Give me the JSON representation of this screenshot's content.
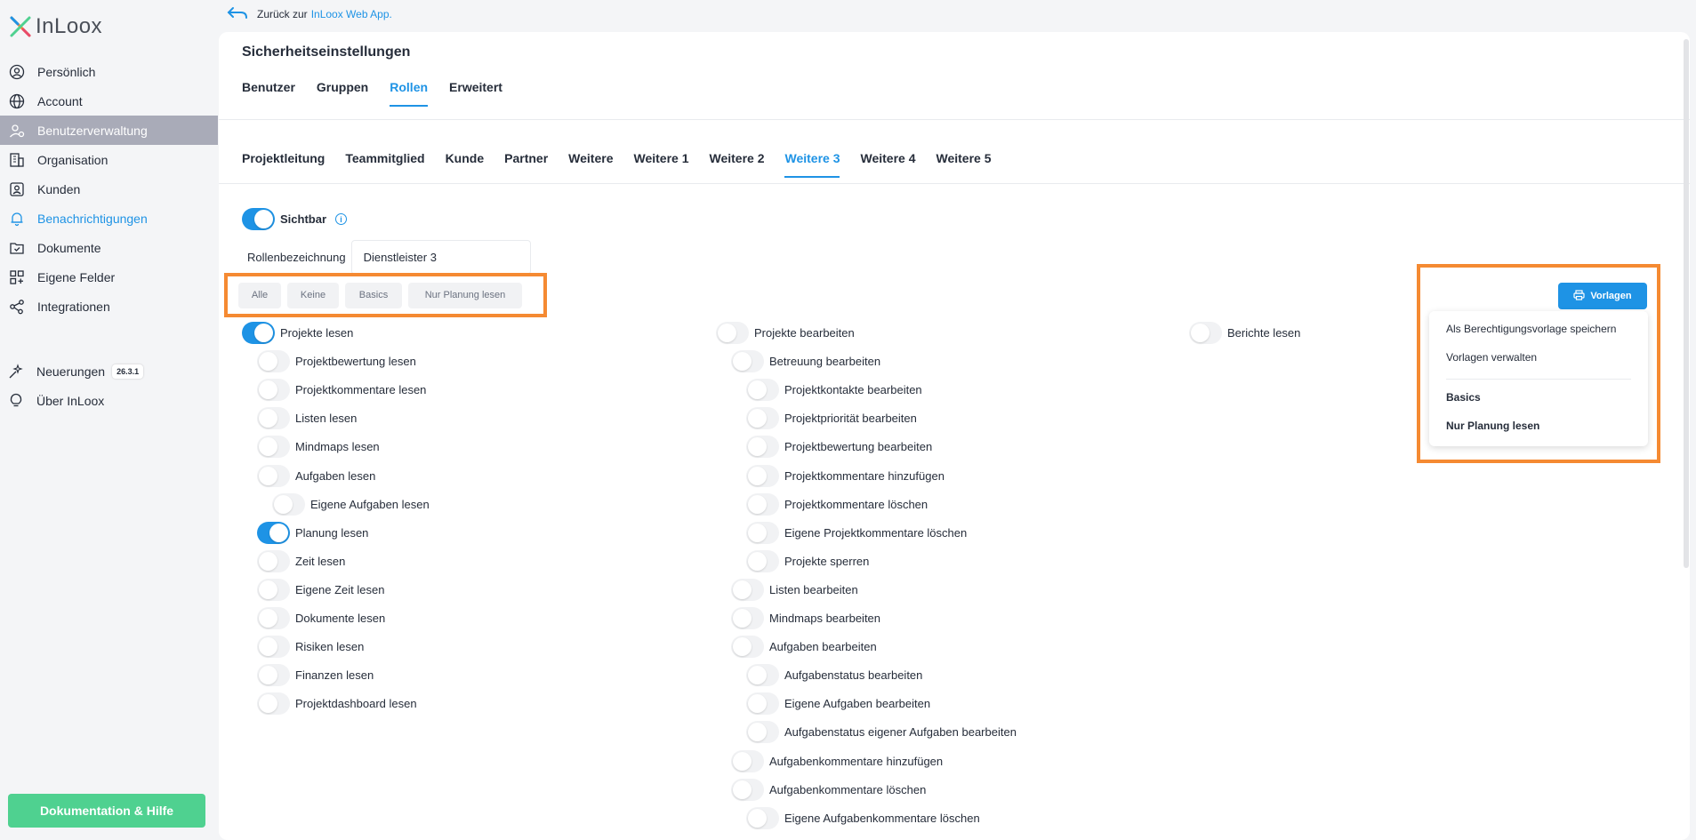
{
  "app": {
    "logo_text": "InLoox",
    "accent": "#1e93e5",
    "highlight": "#f58a32"
  },
  "back": {
    "text": "Zurück zur",
    "link": "InLoox Web App."
  },
  "sidebar": {
    "items": [
      {
        "label": "Persönlich",
        "icon": "person-circle-icon"
      },
      {
        "label": "Account",
        "icon": "globe-icon"
      },
      {
        "label": "Benutzerverwaltung",
        "icon": "users-gear-icon"
      },
      {
        "label": "Organisation",
        "icon": "building-icon"
      },
      {
        "label": "Kunden",
        "icon": "contact-card-icon"
      },
      {
        "label": "Benachrichtigungen",
        "icon": "bell-icon"
      },
      {
        "label": "Dokumente",
        "icon": "folder-check-icon"
      },
      {
        "label": "Eigene Felder",
        "icon": "grid-plus-icon"
      },
      {
        "label": "Integrationen",
        "icon": "share-nodes-icon"
      }
    ],
    "news": {
      "label": "Neuerungen",
      "badge": "26.3.1"
    },
    "about": {
      "label": "Über InLoox"
    },
    "help_button": "Dokumentation & Hilfe"
  },
  "main": {
    "title": "Sicherheitseinstellungen",
    "tabs": [
      "Benutzer",
      "Gruppen",
      "Rollen",
      "Erweitert"
    ],
    "active_tab": "Rollen",
    "role_tabs": [
      "Projektleitung",
      "Teammitglied",
      "Kunde",
      "Partner",
      "Weitere",
      "Weitere 1",
      "Weitere 2",
      "Weitere 3",
      "Weitere 4",
      "Weitere 5"
    ],
    "active_role_tab": "Weitere 3",
    "visible_label": "Sichtbar",
    "visible_on": true,
    "role_name_label": "Rollenbezeichnung",
    "role_name_value": "Dienstleister 3",
    "preset_buttons": [
      "Alle",
      "Keine",
      "Basics",
      "Nur Planung lesen"
    ],
    "templates_button": "Vorlagen",
    "templates_menu": {
      "actions": [
        "Als Berechtigungsvorlage speichern",
        "Vorlagen verwalten"
      ],
      "templates": [
        "Basics",
        "Nur Planung lesen"
      ]
    },
    "col1": [
      {
        "label": "Projekte lesen",
        "on": true
      },
      {
        "label": "Projektbewertung lesen",
        "on": false
      },
      {
        "label": "Projektkommentare lesen",
        "on": false
      },
      {
        "label": "Listen lesen",
        "on": false
      },
      {
        "label": "Mindmaps lesen",
        "on": false
      },
      {
        "label": "Aufgaben lesen",
        "on": false
      },
      {
        "label": "Eigene Aufgaben lesen",
        "on": false
      },
      {
        "label": "Planung lesen",
        "on": true
      },
      {
        "label": "Zeit lesen",
        "on": false
      },
      {
        "label": "Eigene Zeit lesen",
        "on": false
      },
      {
        "label": "Dokumente lesen",
        "on": false
      },
      {
        "label": "Risiken lesen",
        "on": false
      },
      {
        "label": "Finanzen lesen",
        "on": false
      },
      {
        "label": "Projektdashboard lesen",
        "on": false
      }
    ],
    "col2": [
      {
        "label": "Projekte bearbeiten",
        "on": false
      },
      {
        "label": "Betreuung bearbeiten",
        "on": false
      },
      {
        "label": "Projektkontakte bearbeiten",
        "on": false
      },
      {
        "label": "Projektpriorität bearbeiten",
        "on": false
      },
      {
        "label": "Projektbewertung bearbeiten",
        "on": false
      },
      {
        "label": "Projektkommentare hinzufügen",
        "on": false
      },
      {
        "label": "Projektkommentare löschen",
        "on": false
      },
      {
        "label": "Eigene Projektkommentare löschen",
        "on": false
      },
      {
        "label": "Projekte sperren",
        "on": false
      },
      {
        "label": "Listen bearbeiten",
        "on": false
      },
      {
        "label": "Mindmaps bearbeiten",
        "on": false
      },
      {
        "label": "Aufgaben bearbeiten",
        "on": false
      },
      {
        "label": "Aufgabenstatus bearbeiten",
        "on": false
      },
      {
        "label": "Eigene Aufgaben bearbeiten",
        "on": false
      },
      {
        "label": "Aufgabenstatus eigener Aufgaben bearbeiten",
        "on": false
      },
      {
        "label": "Aufgabenkommentare hinzufügen",
        "on": false
      },
      {
        "label": "Aufgabenkommentare löschen",
        "on": false
      },
      {
        "label": "Eigene Aufgabenkommentare löschen",
        "on": false
      }
    ],
    "col3": [
      {
        "label": "Berichte lesen",
        "on": false
      }
    ]
  }
}
